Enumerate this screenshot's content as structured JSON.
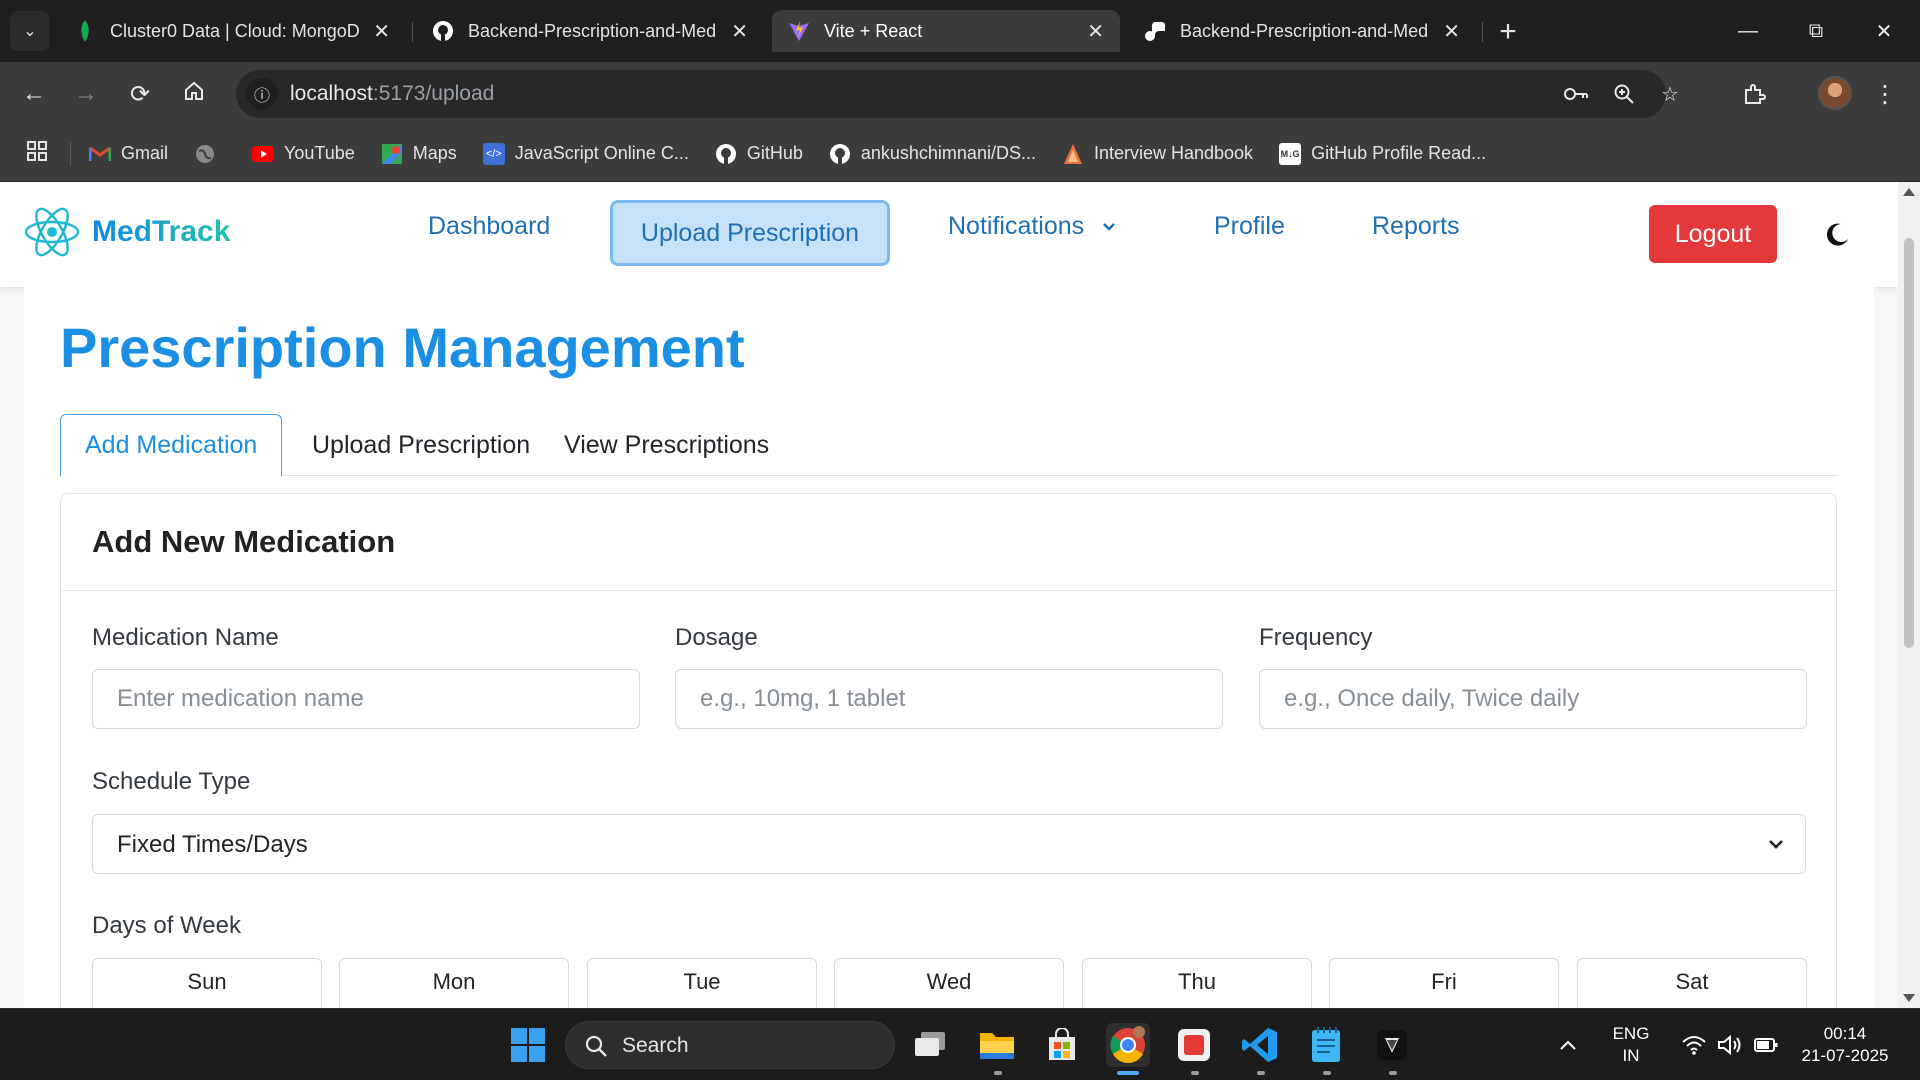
{
  "browser": {
    "tabs": [
      {
        "title": "Cluster0 Data | Cloud: MongoDB",
        "icon": "mongodb-leaf-icon",
        "active": false
      },
      {
        "title": "Backend-Prescription-and-Med",
        "icon": "github-icon",
        "active": false
      },
      {
        "title": "Vite + React",
        "icon": "vite-icon",
        "active": true
      },
      {
        "title": "Backend-Prescription-and-Med",
        "icon": "render-icon",
        "active": false
      }
    ],
    "url_host": "localhost",
    "url_path": ":5173/upload",
    "bookmarks": [
      {
        "label": "Gmail",
        "icon": "gmail-icon"
      },
      {
        "label": "",
        "icon": "globe-icon"
      },
      {
        "label": "YouTube",
        "icon": "youtube-icon"
      },
      {
        "label": "Maps",
        "icon": "maps-icon"
      },
      {
        "label": "JavaScript Online C...",
        "icon": "code-icon"
      },
      {
        "label": "GitHub",
        "icon": "github-icon"
      },
      {
        "label": "ankushchimnani/DS...",
        "icon": "github-icon"
      },
      {
        "label": "Interview Handbook",
        "icon": "handbook-icon"
      },
      {
        "label": "GitHub Profile Read...",
        "icon": "readme-icon"
      }
    ]
  },
  "app": {
    "brand": "MedTrack",
    "nav": {
      "dashboard": "Dashboard",
      "upload": "Upload Prescription",
      "notifications": "Notifications",
      "profile": "Profile",
      "reports": "Reports",
      "logout": "Logout"
    },
    "page_title": "Prescription Management",
    "tabs": [
      "Add Medication",
      "Upload Prescription",
      "View Prescriptions"
    ],
    "active_tab": "Add Medication",
    "form": {
      "title": "Add New Medication",
      "medication_name_label": "Medication Name",
      "medication_name_placeholder": "Enter medication name",
      "dosage_label": "Dosage",
      "dosage_placeholder": "e.g., 10mg, 1 tablet",
      "frequency_label": "Frequency",
      "frequency_placeholder": "e.g., Once daily, Twice daily",
      "schedule_type_label": "Schedule Type",
      "schedule_type_value": "Fixed Times/Days",
      "days_label": "Days of Week",
      "days": [
        "Sun",
        "Mon",
        "Tue",
        "Wed",
        "Thu",
        "Fri",
        "Sat"
      ]
    }
  },
  "colors": {
    "brand_blue": "#1a8fe3",
    "nav_link": "#1f6fb5",
    "logout_red": "#e5383b",
    "active_nav_bg": "#c6e2f8"
  },
  "taskbar": {
    "search": "Search",
    "lang_line1": "ENG",
    "lang_line2": "IN",
    "time": "00:14",
    "date": "21-07-2025"
  }
}
